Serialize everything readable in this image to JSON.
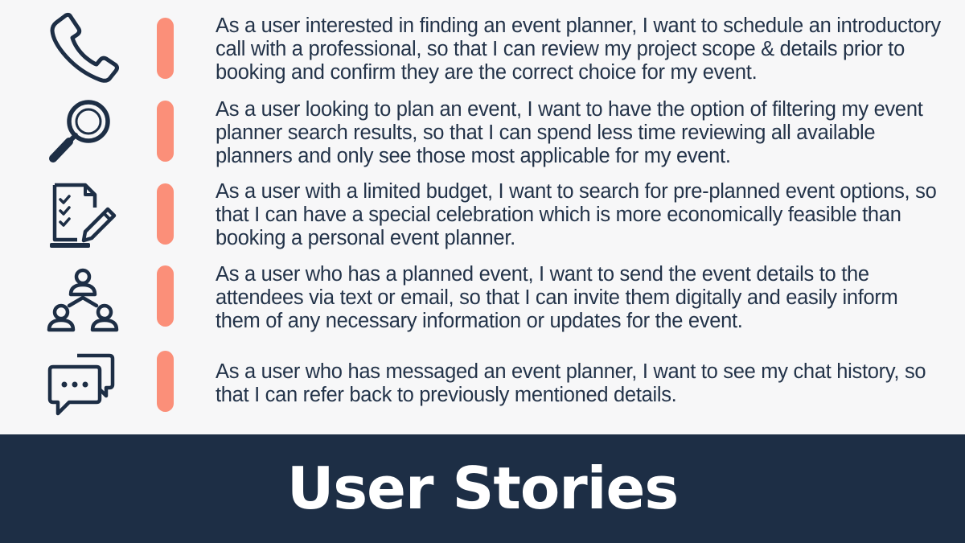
{
  "page": {
    "title": "User Stories"
  },
  "colors": {
    "divider": "#fb8f79",
    "title_bar": "#1d2e45",
    "text": "#233349",
    "icon": "#1d2e45",
    "background": "#f7f7f8"
  },
  "stories": [
    {
      "icon": "phone-icon",
      "text": "As a user interested in finding an event planner, I want to schedule an introductory call with a professional, so that I can review my project scope & details prior to booking and confirm they are the correct choice for my event."
    },
    {
      "icon": "magnifying-glass-icon",
      "text": "As a user looking to plan an event, I want to have the option of filtering my event planner search results, so that I can spend less time reviewing all available planners and only see those most applicable for my event."
    },
    {
      "icon": "checklist-pencil-icon",
      "text": "As a user with a limited budget, I want to search for pre-planned event options, so that I can have a special celebration which is more economically feasible than booking a personal event planner."
    },
    {
      "icon": "people-network-icon",
      "text": "As a user who has a planned event, I want to send the event details to the attendees via text or email, so that I can invite them digitally and easily inform them of any necessary information or updates for the event."
    },
    {
      "icon": "chat-bubbles-icon",
      "text": "As a user who has messaged an event planner, I want to see my chat history, so that I can refer back to previously mentioned details."
    }
  ]
}
